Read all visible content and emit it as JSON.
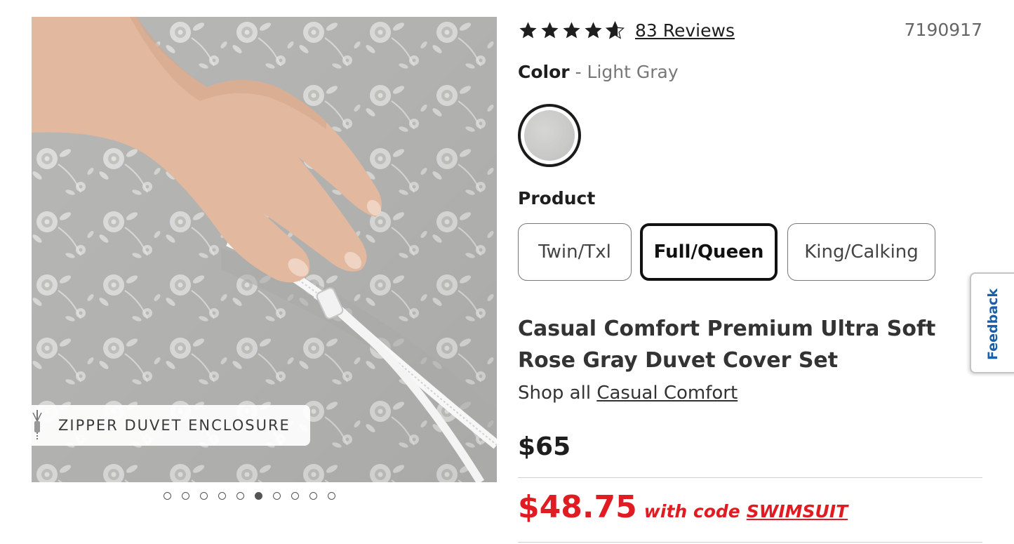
{
  "gallery": {
    "caption": "ZIPPER DUVET ENCLOSURE",
    "image_icon": "zipper-icon",
    "dots_total": 10,
    "active_index": 5
  },
  "rating": {
    "value": 4.5,
    "max": 5,
    "reviews_label": "83 Reviews"
  },
  "sku": "7190917",
  "color": {
    "label": "Color",
    "separator": "-",
    "value": "Light Gray"
  },
  "product": {
    "label": "Product",
    "options": [
      {
        "label": "Twin/Txl",
        "selected": false
      },
      {
        "label": "Full/Queen",
        "selected": true
      },
      {
        "label": "King/Calking",
        "selected": false
      }
    ]
  },
  "title": "Casual Comfort Premium Ultra Soft Rose Gray Duvet Cover Set",
  "shop_all": {
    "prefix": "Shop all",
    "brand": "Casual Comfort"
  },
  "price": {
    "regular": "$65",
    "sale": "$48.75",
    "with_code_text": "with code",
    "code": "SWIMSUIT"
  },
  "feedback_tab": {
    "label": "Feedback"
  },
  "colors": {
    "sale_red": "#e01b22",
    "link_blue": "#1a5fa8",
    "text": "#1e1e1e"
  }
}
